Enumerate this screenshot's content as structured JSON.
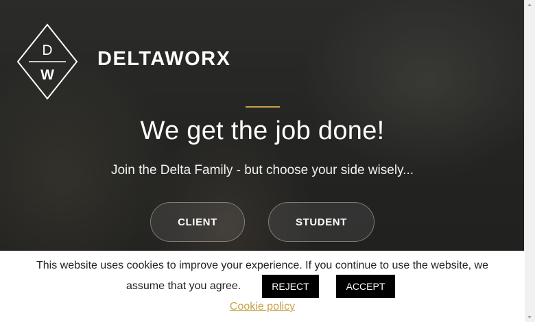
{
  "brand": {
    "name": "DELTAWORX",
    "logo_letters": [
      "D",
      "W"
    ]
  },
  "hero": {
    "headline": "We get the job done!",
    "subline": "Join the Delta Family - but choose your side wisely...",
    "buttons": {
      "client": "CLIENT",
      "student": "STUDENT"
    }
  },
  "cookie": {
    "line1": "This website uses cookies to improve your experience. If you continue to use the website, we",
    "line2": "assume that you agree.",
    "reject": "REJECT",
    "accept": "ACCEPT",
    "policy_link": "Cookie policy"
  },
  "colors": {
    "accent": "#c9a34a",
    "button_bg": "#000000"
  }
}
